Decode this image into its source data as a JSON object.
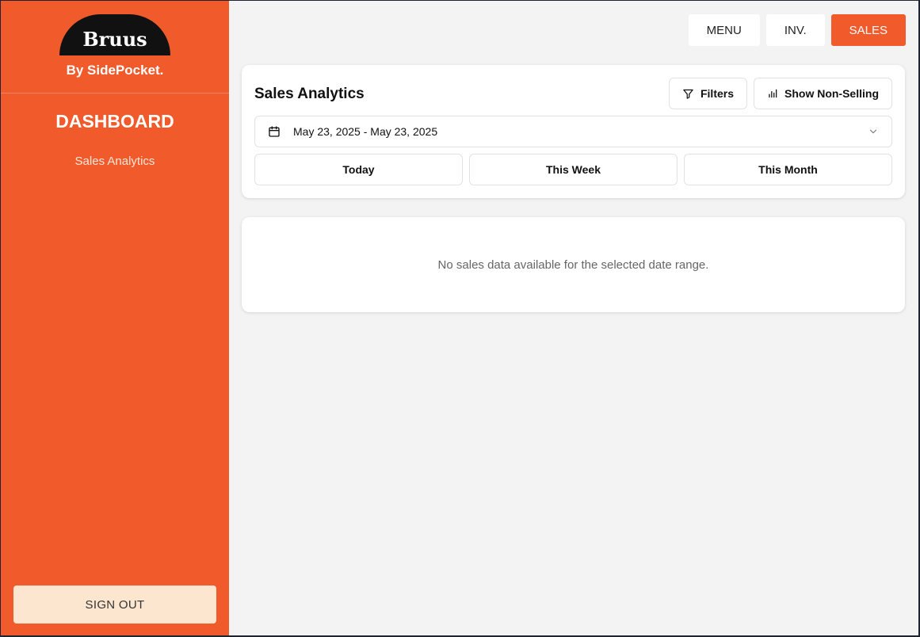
{
  "brand": {
    "name": "Bruus",
    "tagline": "By SidePocket."
  },
  "sidebar": {
    "section_title": "DASHBOARD",
    "items": [
      {
        "label": "Sales Analytics"
      }
    ],
    "signout_label": "SIGN OUT"
  },
  "topnav": {
    "items": [
      {
        "label": "MENU",
        "active": false
      },
      {
        "label": "INV.",
        "active": false
      },
      {
        "label": "SALES",
        "active": true
      }
    ]
  },
  "analytics": {
    "title": "Sales Analytics",
    "filters_label": "Filters",
    "non_selling_label": "Show Non-Selling",
    "date_range": "May 23, 2025 - May 23, 2025",
    "quick_ranges": [
      "Today",
      "This Week",
      "This Month"
    ]
  },
  "results": {
    "empty_message": "No sales data available for the selected date range."
  },
  "colors": {
    "brand": "#f15a2b",
    "signout_bg": "#fde6cf",
    "background": "#f3f3f3"
  },
  "icons": {
    "filters": "filter-icon",
    "non_selling": "bar-chart-icon",
    "date": "calendar-icon",
    "dropdown": "chevron-down-icon"
  }
}
